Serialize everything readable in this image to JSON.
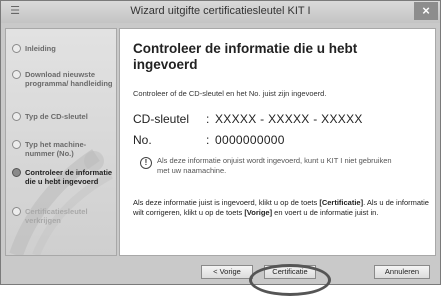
{
  "window": {
    "title": "Wizard uitgifte certificatiesleutel KIT I",
    "close_label": "×"
  },
  "sidebar": {
    "steps": [
      {
        "label": "Inleiding",
        "state": "done"
      },
      {
        "label": "Download nieuwste programma/ handleiding",
        "state": "done"
      },
      {
        "label": "Typ de CD-sleutel",
        "state": "done"
      },
      {
        "label": "Typ het machine- nummer (No.)",
        "state": "done"
      },
      {
        "label": "Controleer de informatie die u hebt ingevoerd",
        "state": "active"
      },
      {
        "label": "Certificatiesleutel verkrijgen",
        "state": "pending"
      }
    ]
  },
  "main": {
    "title": "Controleer de informatie die u hebt ingevoerd",
    "intro": "Controleer of de CD-sleutel en het No. juist zijn ingevoerd.",
    "cd_key_label": "CD-sleutel",
    "cd_key_value": "XXXXX - XXXXX - XXXXX",
    "no_label": "No.",
    "no_value": "0000000000",
    "colon": ":",
    "warning_icon": "!",
    "warning_text": "Als deze informatie onjuist wordt ingevoerd, kunt u KIT I niet gebruiken met uw naamachine.",
    "confirm_1": "Als deze informatie juist is ingevoerd, klikt u op de toets ",
    "confirm_cert": "[Certificatie]",
    "confirm_2": ". Als u de informatie wilt corrigeren, klikt u op de toets ",
    "confirm_prev": "[Vorige]",
    "confirm_3": " en voert u de informatie juist in."
  },
  "footer": {
    "prev_label": "< Vorige",
    "cert_label": "Certificatie",
    "cancel_label": "Annuleren"
  }
}
